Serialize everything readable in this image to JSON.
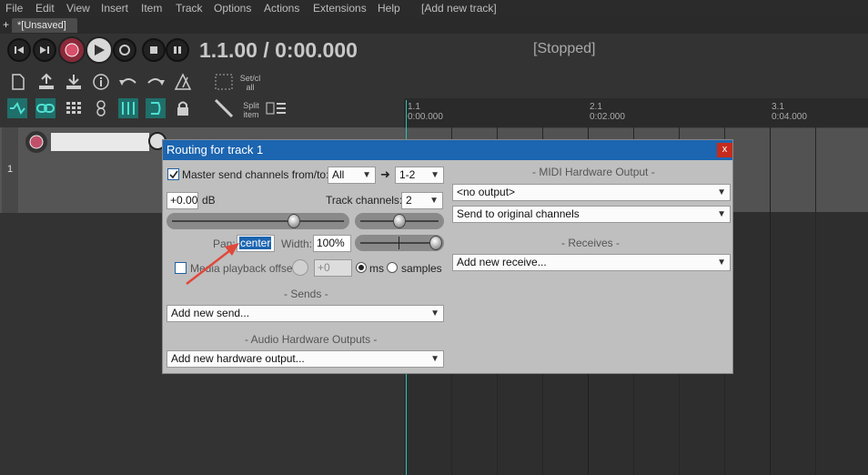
{
  "menu": [
    "File",
    "Edit",
    "View",
    "Insert",
    "Item",
    "Track",
    "Options",
    "Actions",
    "Extensions",
    "Help",
    "[Add new track]"
  ],
  "tabs": {
    "plus": "+",
    "project": "*[Unsaved]"
  },
  "transport": {
    "time": "1.1.00 / 0:00.000",
    "state": "[Stopped]"
  },
  "toolbar": {
    "set_label_1": "Set/cl",
    "set_label_2": "all",
    "split_label_1": "Split",
    "split_label_2": "item"
  },
  "ruler": [
    {
      "bar": "1.1",
      "time": "0:00.000"
    },
    {
      "bar": "2.1",
      "time": "0:02.000"
    },
    {
      "bar": "3.1",
      "time": "0:04.000"
    }
  ],
  "track": {
    "number": "1"
  },
  "dialog": {
    "title": "Routing for track 1",
    "close": "x",
    "master_send_label": "Master send channels from/to:",
    "master_from": "All",
    "master_to": "1-2",
    "arrow": "➜",
    "volume_value": "+0.00",
    "volume_unit": "dB",
    "track_channels_label": "Track channels:",
    "track_channels_value": "2",
    "pan_label": "Pan:",
    "pan_value": "center",
    "width_label": "Width:",
    "width_value": "100%",
    "media_offset_label": "Media playback offset:",
    "media_offset_value": "+0",
    "ms_label": "ms",
    "samples_label": "samples",
    "sends_header": "- Sends -",
    "add_send": "Add new send...",
    "audio_hw_header": "- Audio Hardware Outputs -",
    "add_hw_output": "Add new hardware output...",
    "midi_hw_header": "- MIDI Hardware Output -",
    "midi_output": "<no output>",
    "midi_channels": "Send to original channels",
    "receives_header": "- Receives -",
    "add_receive": "Add new receive..."
  },
  "colors": {
    "accent": "#1c65b0",
    "cursor": "#26c6b4",
    "annotation_arrow": "#e0483a"
  }
}
